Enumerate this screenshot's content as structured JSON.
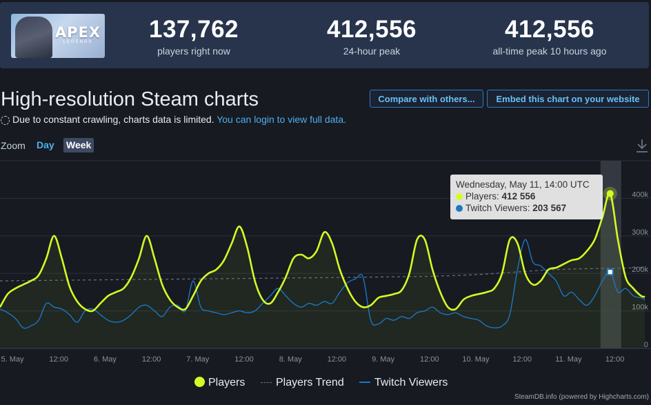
{
  "header": {
    "game_logo": {
      "title": "APEX",
      "subtitle": "LEGENDS"
    },
    "stats": [
      {
        "value": "137,762",
        "label": "players right now"
      },
      {
        "value": "412,556",
        "label": "24-hour peak"
      },
      {
        "value": "412,556",
        "label": "all-time peak 10 hours ago"
      }
    ]
  },
  "page_title": "High-resolution Steam charts",
  "buttons": {
    "compare": "Compare with others...",
    "embed": "Embed this chart on your website"
  },
  "notice": {
    "text": "Due to constant crawling, charts data is limited.",
    "link": "You can login to view full data."
  },
  "zoom": {
    "label": "Zoom",
    "day": "Day",
    "week": "Week"
  },
  "tooltip": {
    "date": "Wednesday, May 11, 14:00 UTC",
    "players_label": "Players:",
    "players_value": "412 556",
    "twitch_label": "Twitch Viewers:",
    "twitch_value": "203 567"
  },
  "legend": {
    "players": "Players",
    "trend": "Players Trend",
    "twitch": "Twitch Viewers"
  },
  "credits": "SteamDB.info (powered by Highcharts.com)",
  "colors": {
    "players": "#d4fb25",
    "twitch": "#1a78c2",
    "trend": "#6a7480",
    "background": "#171a21"
  },
  "chart_data": {
    "type": "line",
    "x_start": "2022-05-05T00:00Z",
    "x_end": "2022-05-11T23:00Z",
    "x_tick_labels": [
      "5. May",
      "12:00",
      "6. May",
      "12:00",
      "7. May",
      "12:00",
      "8. May",
      "12:00",
      "9. May",
      "12:00",
      "10. May",
      "12:00",
      "11. May",
      "12:00"
    ],
    "y_tick_labels": [
      "0",
      "100k",
      "200k",
      "300k",
      "400k"
    ],
    "ylim": [
      0,
      500000
    ],
    "highlight": {
      "x": "2022-05-11T14:00Z"
    },
    "series": [
      {
        "name": "Players",
        "points": [
          [
            "2022-05-05T00:00Z",
            110000
          ],
          [
            "2022-05-05T02:00Z",
            145000
          ],
          [
            "2022-05-05T04:00Z",
            160000
          ],
          [
            "2022-05-05T06:00Z",
            170000
          ],
          [
            "2022-05-05T08:00Z",
            180000
          ],
          [
            "2022-05-05T10:00Z",
            195000
          ],
          [
            "2022-05-05T12:00Z",
            240000
          ],
          [
            "2022-05-05T14:00Z",
            300000
          ],
          [
            "2022-05-05T16:00Z",
            240000
          ],
          [
            "2022-05-05T18:00Z",
            165000
          ],
          [
            "2022-05-05T20:00Z",
            125000
          ],
          [
            "2022-05-05T22:00Z",
            105000
          ],
          [
            "2022-05-06T00:00Z",
            100000
          ],
          [
            "2022-05-06T02:00Z",
            120000
          ],
          [
            "2022-05-06T04:00Z",
            140000
          ],
          [
            "2022-05-06T06:00Z",
            150000
          ],
          [
            "2022-05-06T08:00Z",
            160000
          ],
          [
            "2022-05-06T10:00Z",
            190000
          ],
          [
            "2022-05-06T12:00Z",
            240000
          ],
          [
            "2022-05-06T14:00Z",
            300000
          ],
          [
            "2022-05-06T16:00Z",
            240000
          ],
          [
            "2022-05-06T18:00Z",
            170000
          ],
          [
            "2022-05-06T20:00Z",
            130000
          ],
          [
            "2022-05-06T22:00Z",
            110000
          ],
          [
            "2022-05-07T00:00Z",
            105000
          ],
          [
            "2022-05-07T02:00Z",
            140000
          ],
          [
            "2022-05-07T04:00Z",
            180000
          ],
          [
            "2022-05-07T06:00Z",
            200000
          ],
          [
            "2022-05-07T08:00Z",
            210000
          ],
          [
            "2022-05-07T10:00Z",
            235000
          ],
          [
            "2022-05-07T12:00Z",
            280000
          ],
          [
            "2022-05-07T14:00Z",
            325000
          ],
          [
            "2022-05-07T16:00Z",
            270000
          ],
          [
            "2022-05-07T18:00Z",
            180000
          ],
          [
            "2022-05-07T20:00Z",
            130000
          ],
          [
            "2022-05-07T22:00Z",
            120000
          ],
          [
            "2022-05-08T00:00Z",
            150000
          ],
          [
            "2022-05-08T02:00Z",
            190000
          ],
          [
            "2022-05-08T04:00Z",
            240000
          ],
          [
            "2022-05-08T06:00Z",
            250000
          ],
          [
            "2022-05-08T08:00Z",
            240000
          ],
          [
            "2022-05-08T10:00Z",
            260000
          ],
          [
            "2022-05-08T12:00Z",
            310000
          ],
          [
            "2022-05-08T14:00Z",
            280000
          ],
          [
            "2022-05-08T16:00Z",
            210000
          ],
          [
            "2022-05-08T18:00Z",
            160000
          ],
          [
            "2022-05-08T20:00Z",
            125000
          ],
          [
            "2022-05-08T22:00Z",
            110000
          ],
          [
            "2022-05-09T00:00Z",
            115000
          ],
          [
            "2022-05-09T02:00Z",
            135000
          ],
          [
            "2022-05-09T04:00Z",
            140000
          ],
          [
            "2022-05-09T06:00Z",
            145000
          ],
          [
            "2022-05-09T08:00Z",
            155000
          ],
          [
            "2022-05-09T10:00Z",
            200000
          ],
          [
            "2022-05-09T12:00Z",
            290000
          ],
          [
            "2022-05-09T14:00Z",
            290000
          ],
          [
            "2022-05-09T16:00Z",
            210000
          ],
          [
            "2022-05-09T18:00Z",
            150000
          ],
          [
            "2022-05-09T20:00Z",
            110000
          ],
          [
            "2022-05-09T22:00Z",
            105000
          ],
          [
            "2022-05-10T00:00Z",
            130000
          ],
          [
            "2022-05-10T02:00Z",
            140000
          ],
          [
            "2022-05-10T04:00Z",
            145000
          ],
          [
            "2022-05-10T06:00Z",
            150000
          ],
          [
            "2022-05-10T08:00Z",
            160000
          ],
          [
            "2022-05-10T10:00Z",
            200000
          ],
          [
            "2022-05-10T12:00Z",
            290000
          ],
          [
            "2022-05-10T14:00Z",
            280000
          ],
          [
            "2022-05-10T16:00Z",
            200000
          ],
          [
            "2022-05-10T18:00Z",
            170000
          ],
          [
            "2022-05-10T20:00Z",
            180000
          ],
          [
            "2022-05-10T22:00Z",
            210000
          ],
          [
            "2022-05-11T00:00Z",
            215000
          ],
          [
            "2022-05-11T02:00Z",
            225000
          ],
          [
            "2022-05-11T04:00Z",
            235000
          ],
          [
            "2022-05-11T06:00Z",
            240000
          ],
          [
            "2022-05-11T08:00Z",
            260000
          ],
          [
            "2022-05-11T10:00Z",
            290000
          ],
          [
            "2022-05-11T12:00Z",
            350000
          ],
          [
            "2022-05-11T14:00Z",
            412556
          ],
          [
            "2022-05-11T16:00Z",
            290000
          ],
          [
            "2022-05-11T18:00Z",
            190000
          ],
          [
            "2022-05-11T20:00Z",
            160000
          ],
          [
            "2022-05-11T22:00Z",
            140000
          ],
          [
            "2022-05-11T23:00Z",
            137762
          ]
        ]
      },
      {
        "name": "Twitch Viewers",
        "points": [
          [
            "2022-05-05T00:00Z",
            105000
          ],
          [
            "2022-05-05T02:00Z",
            95000
          ],
          [
            "2022-05-05T04:00Z",
            80000
          ],
          [
            "2022-05-05T06:00Z",
            55000
          ],
          [
            "2022-05-05T08:00Z",
            60000
          ],
          [
            "2022-05-05T10:00Z",
            75000
          ],
          [
            "2022-05-05T12:00Z",
            120000
          ],
          [
            "2022-05-05T14:00Z",
            110000
          ],
          [
            "2022-05-05T16:00Z",
            105000
          ],
          [
            "2022-05-05T18:00Z",
            90000
          ],
          [
            "2022-05-05T20:00Z",
            70000
          ],
          [
            "2022-05-05T22:00Z",
            100000
          ],
          [
            "2022-05-06T00:00Z",
            105000
          ],
          [
            "2022-05-06T02:00Z",
            90000
          ],
          [
            "2022-05-06T04:00Z",
            75000
          ],
          [
            "2022-05-06T06:00Z",
            70000
          ],
          [
            "2022-05-06T08:00Z",
            75000
          ],
          [
            "2022-05-06T10:00Z",
            90000
          ],
          [
            "2022-05-06T12:00Z",
            110000
          ],
          [
            "2022-05-06T14:00Z",
            115000
          ],
          [
            "2022-05-06T16:00Z",
            100000
          ],
          [
            "2022-05-06T18:00Z",
            85000
          ],
          [
            "2022-05-06T20:00Z",
            110000
          ],
          [
            "2022-05-06T22:00Z",
            115000
          ],
          [
            "2022-05-07T00:00Z",
            100000
          ],
          [
            "2022-05-07T02:00Z",
            180000
          ],
          [
            "2022-05-07T04:00Z",
            110000
          ],
          [
            "2022-05-07T06:00Z",
            100000
          ],
          [
            "2022-05-07T08:00Z",
            95000
          ],
          [
            "2022-05-07T10:00Z",
            90000
          ],
          [
            "2022-05-07T12:00Z",
            95000
          ],
          [
            "2022-05-07T14:00Z",
            100000
          ],
          [
            "2022-05-07T16:00Z",
            95000
          ],
          [
            "2022-05-07T18:00Z",
            100000
          ],
          [
            "2022-05-07T20:00Z",
            120000
          ],
          [
            "2022-05-07T22:00Z",
            140000
          ],
          [
            "2022-05-08T00:00Z",
            160000
          ],
          [
            "2022-05-08T02:00Z",
            140000
          ],
          [
            "2022-05-08T04:00Z",
            120000
          ],
          [
            "2022-05-08T06:00Z",
            110000
          ],
          [
            "2022-05-08T08:00Z",
            120000
          ],
          [
            "2022-05-08T10:00Z",
            115000
          ],
          [
            "2022-05-08T12:00Z",
            125000
          ],
          [
            "2022-05-08T14:00Z",
            120000
          ],
          [
            "2022-05-08T16:00Z",
            150000
          ],
          [
            "2022-05-08T18:00Z",
            175000
          ],
          [
            "2022-05-08T20:00Z",
            185000
          ],
          [
            "2022-05-08T22:00Z",
            190000
          ],
          [
            "2022-05-09T00:00Z",
            75000
          ],
          [
            "2022-05-09T02:00Z",
            65000
          ],
          [
            "2022-05-09T04:00Z",
            80000
          ],
          [
            "2022-05-09T06:00Z",
            75000
          ],
          [
            "2022-05-09T08:00Z",
            85000
          ],
          [
            "2022-05-09T10:00Z",
            80000
          ],
          [
            "2022-05-09T12:00Z",
            95000
          ],
          [
            "2022-05-09T14:00Z",
            100000
          ],
          [
            "2022-05-09T16:00Z",
            110000
          ],
          [
            "2022-05-09T18:00Z",
            95000
          ],
          [
            "2022-05-09T20:00Z",
            90000
          ],
          [
            "2022-05-09T22:00Z",
            95000
          ],
          [
            "2022-05-10T00:00Z",
            85000
          ],
          [
            "2022-05-10T02:00Z",
            80000
          ],
          [
            "2022-05-10T04:00Z",
            75000
          ],
          [
            "2022-05-10T06:00Z",
            60000
          ],
          [
            "2022-05-10T08:00Z",
            55000
          ],
          [
            "2022-05-10T10:00Z",
            60000
          ],
          [
            "2022-05-10T12:00Z",
            90000
          ],
          [
            "2022-05-10T14:00Z",
            210000
          ],
          [
            "2022-05-10T16:00Z",
            290000
          ],
          [
            "2022-05-10T18:00Z",
            230000
          ],
          [
            "2022-05-10T20:00Z",
            220000
          ],
          [
            "2022-05-10T22:00Z",
            200000
          ],
          [
            "2022-05-11T00:00Z",
            180000
          ],
          [
            "2022-05-11T02:00Z",
            140000
          ],
          [
            "2022-05-11T04:00Z",
            150000
          ],
          [
            "2022-05-11T06:00Z",
            130000
          ],
          [
            "2022-05-11T08:00Z",
            115000
          ],
          [
            "2022-05-11T10:00Z",
            140000
          ],
          [
            "2022-05-11T12:00Z",
            180000
          ],
          [
            "2022-05-11T14:00Z",
            203567
          ],
          [
            "2022-05-11T16:00Z",
            150000
          ],
          [
            "2022-05-11T18:00Z",
            160000
          ],
          [
            "2022-05-11T20:00Z",
            140000
          ],
          [
            "2022-05-11T22:00Z",
            135000
          ],
          [
            "2022-05-11T23:00Z",
            130000
          ]
        ]
      },
      {
        "name": "Players Trend",
        "style": "dashed",
        "points": [
          [
            "2022-05-05T00:00Z",
            180000
          ],
          [
            "2022-05-07T00:00Z",
            185000
          ],
          [
            "2022-05-09T00:00Z",
            190000
          ],
          [
            "2022-05-10T00:00Z",
            195000
          ],
          [
            "2022-05-11T00:00Z",
            210000
          ],
          [
            "2022-05-11T23:00Z",
            215000
          ]
        ]
      }
    ]
  }
}
